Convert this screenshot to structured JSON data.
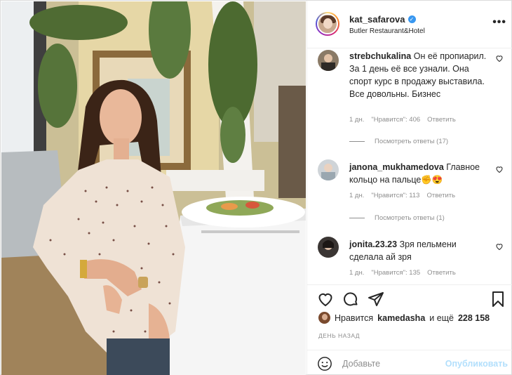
{
  "post": {
    "username": "kat_safarova",
    "verified": true,
    "location": "Butler Restaurant&Hotel",
    "more_icon": "more-horizontal-icon"
  },
  "comments": [
    {
      "username": "strebchukalina",
      "text": "Он её пропиарил. За 1 день её все узнали. Она спорт курс в продажу выставила. Все довольны. Бизнес",
      "age": "1 дн.",
      "likes": "\"Нравится\": 406",
      "reply": "Ответить",
      "view_replies": "Посмотреть ответы (17)"
    },
    {
      "username": "janona_mukhamedova",
      "text": "Главное кольцо на пальце✊😍",
      "age": "1 дн.",
      "likes": "\"Нравится\": 113",
      "reply": "Ответить",
      "view_replies": "Посмотреть ответы (1)"
    },
    {
      "username": "jonita.23.23",
      "text": "Зря пельмени сделала ай зря",
      "age": "1 дн.",
      "likes": "\"Нравится\": 135",
      "reply": "Ответить"
    }
  ],
  "likes_summary": {
    "prefix": "Нравится",
    "user": "kamedasha",
    "middle": "и ещё",
    "count": "228 158"
  },
  "date": "ДЕНЬ НАЗАД",
  "add_comment": {
    "placeholder": "Добавьте",
    "publish_label": "Опубликовать"
  },
  "icons": [
    "heart-icon",
    "comment-icon",
    "share-icon",
    "bookmark-icon",
    "emoji-icon"
  ],
  "colors": {
    "verified": "#3897f0",
    "publish_disabled": "#b2dffc",
    "meta": "#8e8e8e"
  }
}
